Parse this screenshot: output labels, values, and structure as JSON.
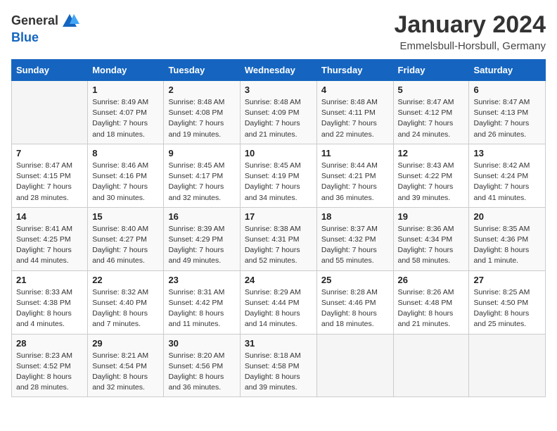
{
  "header": {
    "logo_general": "General",
    "logo_blue": "Blue",
    "month": "January 2024",
    "location": "Emmelsbull-Horsbull, Germany"
  },
  "weekdays": [
    "Sunday",
    "Monday",
    "Tuesday",
    "Wednesday",
    "Thursday",
    "Friday",
    "Saturday"
  ],
  "weeks": [
    [
      {
        "day": "",
        "sunrise": "",
        "sunset": "",
        "daylight": ""
      },
      {
        "day": "1",
        "sunrise": "Sunrise: 8:49 AM",
        "sunset": "Sunset: 4:07 PM",
        "daylight": "Daylight: 7 hours and 18 minutes."
      },
      {
        "day": "2",
        "sunrise": "Sunrise: 8:48 AM",
        "sunset": "Sunset: 4:08 PM",
        "daylight": "Daylight: 7 hours and 19 minutes."
      },
      {
        "day": "3",
        "sunrise": "Sunrise: 8:48 AM",
        "sunset": "Sunset: 4:09 PM",
        "daylight": "Daylight: 7 hours and 21 minutes."
      },
      {
        "day": "4",
        "sunrise": "Sunrise: 8:48 AM",
        "sunset": "Sunset: 4:11 PM",
        "daylight": "Daylight: 7 hours and 22 minutes."
      },
      {
        "day": "5",
        "sunrise": "Sunrise: 8:47 AM",
        "sunset": "Sunset: 4:12 PM",
        "daylight": "Daylight: 7 hours and 24 minutes."
      },
      {
        "day": "6",
        "sunrise": "Sunrise: 8:47 AM",
        "sunset": "Sunset: 4:13 PM",
        "daylight": "Daylight: 7 hours and 26 minutes."
      }
    ],
    [
      {
        "day": "7",
        "sunrise": "Sunrise: 8:47 AM",
        "sunset": "Sunset: 4:15 PM",
        "daylight": "Daylight: 7 hours and 28 minutes."
      },
      {
        "day": "8",
        "sunrise": "Sunrise: 8:46 AM",
        "sunset": "Sunset: 4:16 PM",
        "daylight": "Daylight: 7 hours and 30 minutes."
      },
      {
        "day": "9",
        "sunrise": "Sunrise: 8:45 AM",
        "sunset": "Sunset: 4:17 PM",
        "daylight": "Daylight: 7 hours and 32 minutes."
      },
      {
        "day": "10",
        "sunrise": "Sunrise: 8:45 AM",
        "sunset": "Sunset: 4:19 PM",
        "daylight": "Daylight: 7 hours and 34 minutes."
      },
      {
        "day": "11",
        "sunrise": "Sunrise: 8:44 AM",
        "sunset": "Sunset: 4:21 PM",
        "daylight": "Daylight: 7 hours and 36 minutes."
      },
      {
        "day": "12",
        "sunrise": "Sunrise: 8:43 AM",
        "sunset": "Sunset: 4:22 PM",
        "daylight": "Daylight: 7 hours and 39 minutes."
      },
      {
        "day": "13",
        "sunrise": "Sunrise: 8:42 AM",
        "sunset": "Sunset: 4:24 PM",
        "daylight": "Daylight: 7 hours and 41 minutes."
      }
    ],
    [
      {
        "day": "14",
        "sunrise": "Sunrise: 8:41 AM",
        "sunset": "Sunset: 4:25 PM",
        "daylight": "Daylight: 7 hours and 44 minutes."
      },
      {
        "day": "15",
        "sunrise": "Sunrise: 8:40 AM",
        "sunset": "Sunset: 4:27 PM",
        "daylight": "Daylight: 7 hours and 46 minutes."
      },
      {
        "day": "16",
        "sunrise": "Sunrise: 8:39 AM",
        "sunset": "Sunset: 4:29 PM",
        "daylight": "Daylight: 7 hours and 49 minutes."
      },
      {
        "day": "17",
        "sunrise": "Sunrise: 8:38 AM",
        "sunset": "Sunset: 4:31 PM",
        "daylight": "Daylight: 7 hours and 52 minutes."
      },
      {
        "day": "18",
        "sunrise": "Sunrise: 8:37 AM",
        "sunset": "Sunset: 4:32 PM",
        "daylight": "Daylight: 7 hours and 55 minutes."
      },
      {
        "day": "19",
        "sunrise": "Sunrise: 8:36 AM",
        "sunset": "Sunset: 4:34 PM",
        "daylight": "Daylight: 7 hours and 58 minutes."
      },
      {
        "day": "20",
        "sunrise": "Sunrise: 8:35 AM",
        "sunset": "Sunset: 4:36 PM",
        "daylight": "Daylight: 8 hours and 1 minute."
      }
    ],
    [
      {
        "day": "21",
        "sunrise": "Sunrise: 8:33 AM",
        "sunset": "Sunset: 4:38 PM",
        "daylight": "Daylight: 8 hours and 4 minutes."
      },
      {
        "day": "22",
        "sunrise": "Sunrise: 8:32 AM",
        "sunset": "Sunset: 4:40 PM",
        "daylight": "Daylight: 8 hours and 7 minutes."
      },
      {
        "day": "23",
        "sunrise": "Sunrise: 8:31 AM",
        "sunset": "Sunset: 4:42 PM",
        "daylight": "Daylight: 8 hours and 11 minutes."
      },
      {
        "day": "24",
        "sunrise": "Sunrise: 8:29 AM",
        "sunset": "Sunset: 4:44 PM",
        "daylight": "Daylight: 8 hours and 14 minutes."
      },
      {
        "day": "25",
        "sunrise": "Sunrise: 8:28 AM",
        "sunset": "Sunset: 4:46 PM",
        "daylight": "Daylight: 8 hours and 18 minutes."
      },
      {
        "day": "26",
        "sunrise": "Sunrise: 8:26 AM",
        "sunset": "Sunset: 4:48 PM",
        "daylight": "Daylight: 8 hours and 21 minutes."
      },
      {
        "day": "27",
        "sunrise": "Sunrise: 8:25 AM",
        "sunset": "Sunset: 4:50 PM",
        "daylight": "Daylight: 8 hours and 25 minutes."
      }
    ],
    [
      {
        "day": "28",
        "sunrise": "Sunrise: 8:23 AM",
        "sunset": "Sunset: 4:52 PM",
        "daylight": "Daylight: 8 hours and 28 minutes."
      },
      {
        "day": "29",
        "sunrise": "Sunrise: 8:21 AM",
        "sunset": "Sunset: 4:54 PM",
        "daylight": "Daylight: 8 hours and 32 minutes."
      },
      {
        "day": "30",
        "sunrise": "Sunrise: 8:20 AM",
        "sunset": "Sunset: 4:56 PM",
        "daylight": "Daylight: 8 hours and 36 minutes."
      },
      {
        "day": "31",
        "sunrise": "Sunrise: 8:18 AM",
        "sunset": "Sunset: 4:58 PM",
        "daylight": "Daylight: 8 hours and 39 minutes."
      },
      {
        "day": "",
        "sunrise": "",
        "sunset": "",
        "daylight": ""
      },
      {
        "day": "",
        "sunrise": "",
        "sunset": "",
        "daylight": ""
      },
      {
        "day": "",
        "sunrise": "",
        "sunset": "",
        "daylight": ""
      }
    ]
  ]
}
